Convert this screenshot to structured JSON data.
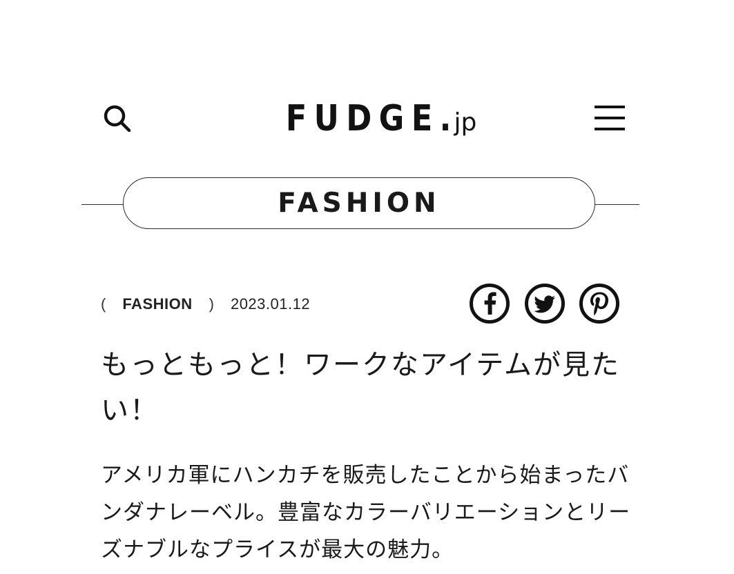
{
  "header": {
    "logo_main": "FUDGE.",
    "logo_sub": "jp",
    "search_icon": "search-icon",
    "menu_icon": "hamburger-menu-icon"
  },
  "category_banner": {
    "label": "FASHION"
  },
  "article": {
    "meta": {
      "paren_open": "(",
      "category": "FASHION",
      "paren_close": ")",
      "date": "2023.01.12"
    },
    "share": [
      {
        "icon": "facebook-icon"
      },
      {
        "icon": "twitter-icon"
      },
      {
        "icon": "pinterest-icon"
      }
    ],
    "title": "もっともっと！ワークなアイテムが見たい！",
    "lead": "アメリカ軍にハンカチを販売したことから始まったバンダナレーベル。豊富なカラーバリエーションとリーズナブルなプライスが最大の魅力。"
  },
  "colors": {
    "text": "#1a1a1a",
    "background": "#ffffff",
    "line": "#2a2a2a"
  }
}
